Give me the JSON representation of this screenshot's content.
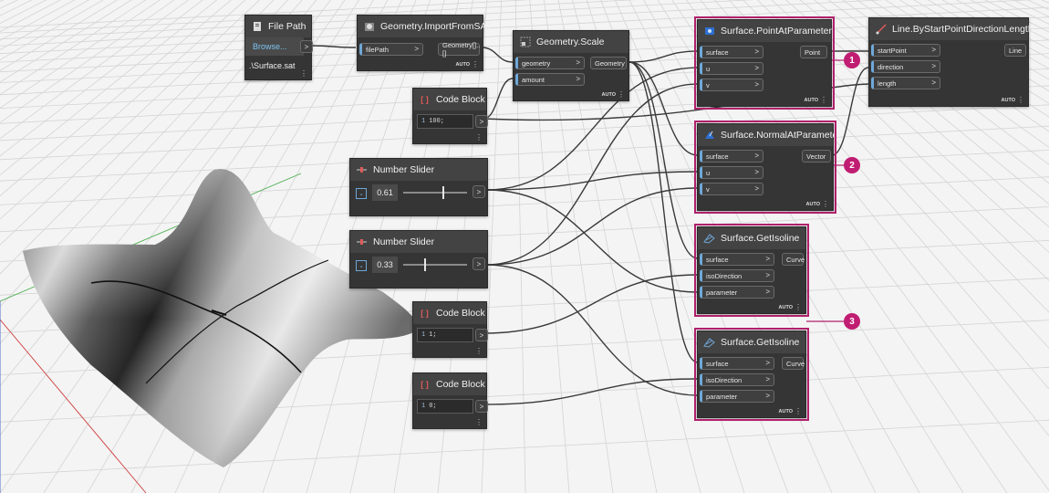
{
  "colors": {
    "highlight": "#b0206b",
    "badge": "#c01d72",
    "node_body": "#353535",
    "node_header": "#434343",
    "wire": "#3a3a3a",
    "port_in": "#6fa8d8"
  },
  "nodes": {
    "file_path": {
      "title": "File Path",
      "browse": "Browse...",
      "value": ".\\Surface.sat",
      "icon": "file-icon"
    },
    "import_sat": {
      "title": "Geometry.ImportFromSAT",
      "in": [
        "filePath"
      ],
      "out": "Geometry[]..[]",
      "auto": "AUTO",
      "icon": "import-icon"
    },
    "scale": {
      "title": "Geometry.Scale",
      "in": [
        "geometry",
        "amount"
      ],
      "out": "Geometry",
      "auto": "AUTO",
      "icon": "scale-icon"
    },
    "code1": {
      "title": "Code Block",
      "line": "1",
      "code": "100;",
      "icon": "code-block-icon"
    },
    "slider1": {
      "title": "Number Slider",
      "value": "0.61",
      "level": 0.61,
      "icon": "slider-icon"
    },
    "slider2": {
      "title": "Number Slider",
      "value": "0.33",
      "level": 0.33,
      "icon": "slider-icon"
    },
    "code2": {
      "title": "Code Block",
      "line": "1",
      "code": "1;",
      "icon": "code-block-icon"
    },
    "code3": {
      "title": "Code Block",
      "line": "1",
      "code": "0;",
      "icon": "code-block-icon"
    },
    "point_at": {
      "title": "Surface.PointAtParameter",
      "in": [
        "surface",
        "u",
        "v"
      ],
      "out": "Point",
      "auto": "AUTO",
      "icon": "surface-icon"
    },
    "normal_at": {
      "title": "Surface.NormalAtParameter",
      "in": [
        "surface",
        "u",
        "v"
      ],
      "out": "Vector",
      "auto": "AUTO",
      "icon": "surface-icon"
    },
    "isoline1": {
      "title": "Surface.GetIsoline",
      "in": [
        "surface",
        "isoDirection",
        "parameter"
      ],
      "out": "Curve",
      "auto": "AUTO",
      "icon": "isoline-icon"
    },
    "isoline2": {
      "title": "Surface.GetIsoline",
      "in": [
        "surface",
        "isoDirection",
        "parameter"
      ],
      "out": "Curve",
      "auto": "AUTO",
      "icon": "isoline-icon"
    },
    "line_by": {
      "title": "Line.ByStartPointDirectionLength",
      "in": [
        "startPoint",
        "direction",
        "length"
      ],
      "out": "Line",
      "auto": "AUTO",
      "icon": "line-icon"
    }
  },
  "badges": [
    "1",
    "2",
    "3"
  ]
}
